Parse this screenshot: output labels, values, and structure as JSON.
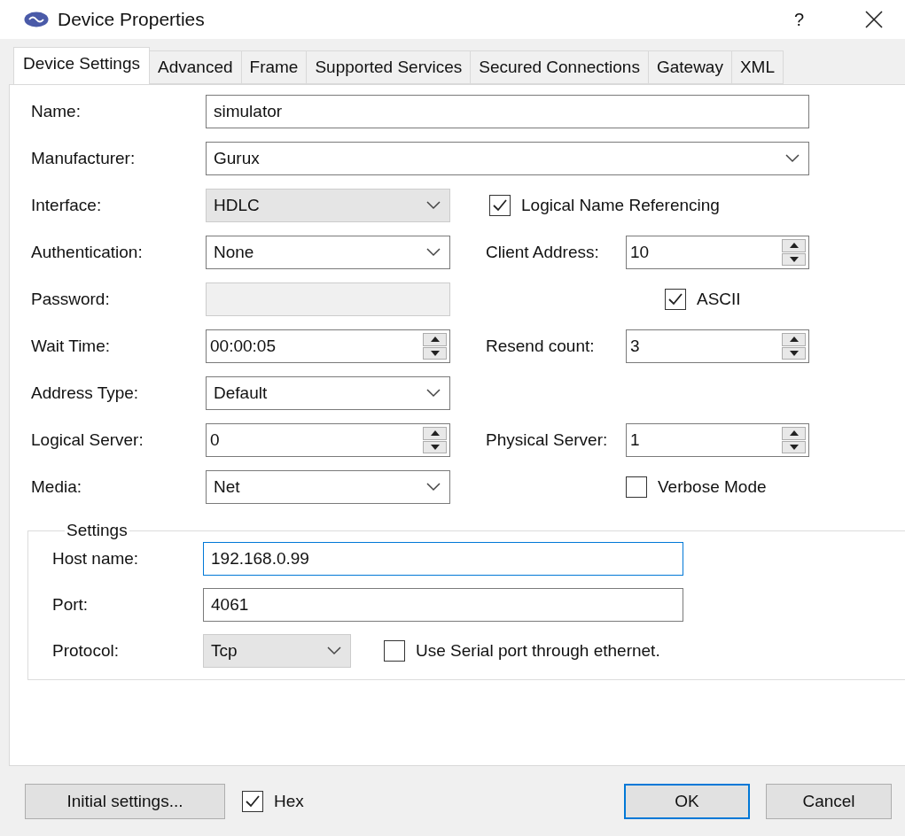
{
  "window": {
    "title": "Device Properties",
    "help": "?"
  },
  "tabs": [
    {
      "label": "Device Settings",
      "selected": true
    },
    {
      "label": "Advanced",
      "selected": false
    },
    {
      "label": "Frame",
      "selected": false
    },
    {
      "label": "Supported Services",
      "selected": false
    },
    {
      "label": "Secured Connections",
      "selected": false
    },
    {
      "label": "Gateway",
      "selected": false
    },
    {
      "label": "XML",
      "selected": false
    }
  ],
  "rows": [
    {
      "left": {
        "label": "Name:",
        "kind": "wide-text",
        "value": "simulator"
      }
    },
    {
      "left": {
        "label": "Manufacturer:",
        "kind": "wide-combo",
        "value": "Gurux"
      }
    },
    {
      "left": {
        "label": "Interface:",
        "kind": "list",
        "value": "HDLC"
      },
      "right": {
        "kind": "checkbox",
        "label": "Logical Name Referencing",
        "checked": true
      }
    },
    {
      "left": {
        "label": "Authentication:",
        "kind": "combo",
        "value": "None"
      },
      "right": {
        "kind": "spinner",
        "label": "Client Address:",
        "value": "10"
      }
    },
    {
      "left": {
        "label": "Password:",
        "kind": "text",
        "disabled": true
      },
      "right": {
        "kind": "checkbox",
        "label": "ASCII",
        "checked": true
      }
    },
    {
      "left": {
        "label": "Wait Time:",
        "kind": "spinner",
        "value": "00:00:05"
      },
      "right": {
        "kind": "spinner",
        "label": "Resend count:",
        "value": "3"
      }
    },
    {
      "left": {
        "label": "Address Type:",
        "kind": "combo",
        "value": "Default"
      }
    },
    {
      "left": {
        "label": "Logical Server:",
        "kind": "spinner",
        "value": "0"
      },
      "right": {
        "kind": "spinner",
        "label": "Physical Server:",
        "value": "1"
      }
    },
    {
      "left": {
        "label": "Media:",
        "kind": "combo",
        "value": "Net"
      },
      "right": {
        "kind": "checkbox",
        "label": "Verbose Mode",
        "checked": false
      }
    }
  ],
  "settings": {
    "legend": "Settings",
    "rows": [
      {
        "label": "Host name:",
        "kind": "text",
        "value": "192.168.0.99",
        "focused": true
      },
      {
        "label": "Port:",
        "kind": "text",
        "value": "4061",
        "focused": false
      },
      {
        "label": "Protocol:",
        "kind": "list",
        "value": "Tcp",
        "focused": false,
        "option": {
          "label": "Use Serial port through ethernet.",
          "checked": false
        }
      }
    ]
  },
  "footer": {
    "initial_button": "Initial settings...",
    "hex": {
      "label": "Hex",
      "checked": true
    },
    "buttons": [
      {
        "label": "OK",
        "default": true
      },
      {
        "label": "Cancel",
        "default": false
      }
    ]
  }
}
